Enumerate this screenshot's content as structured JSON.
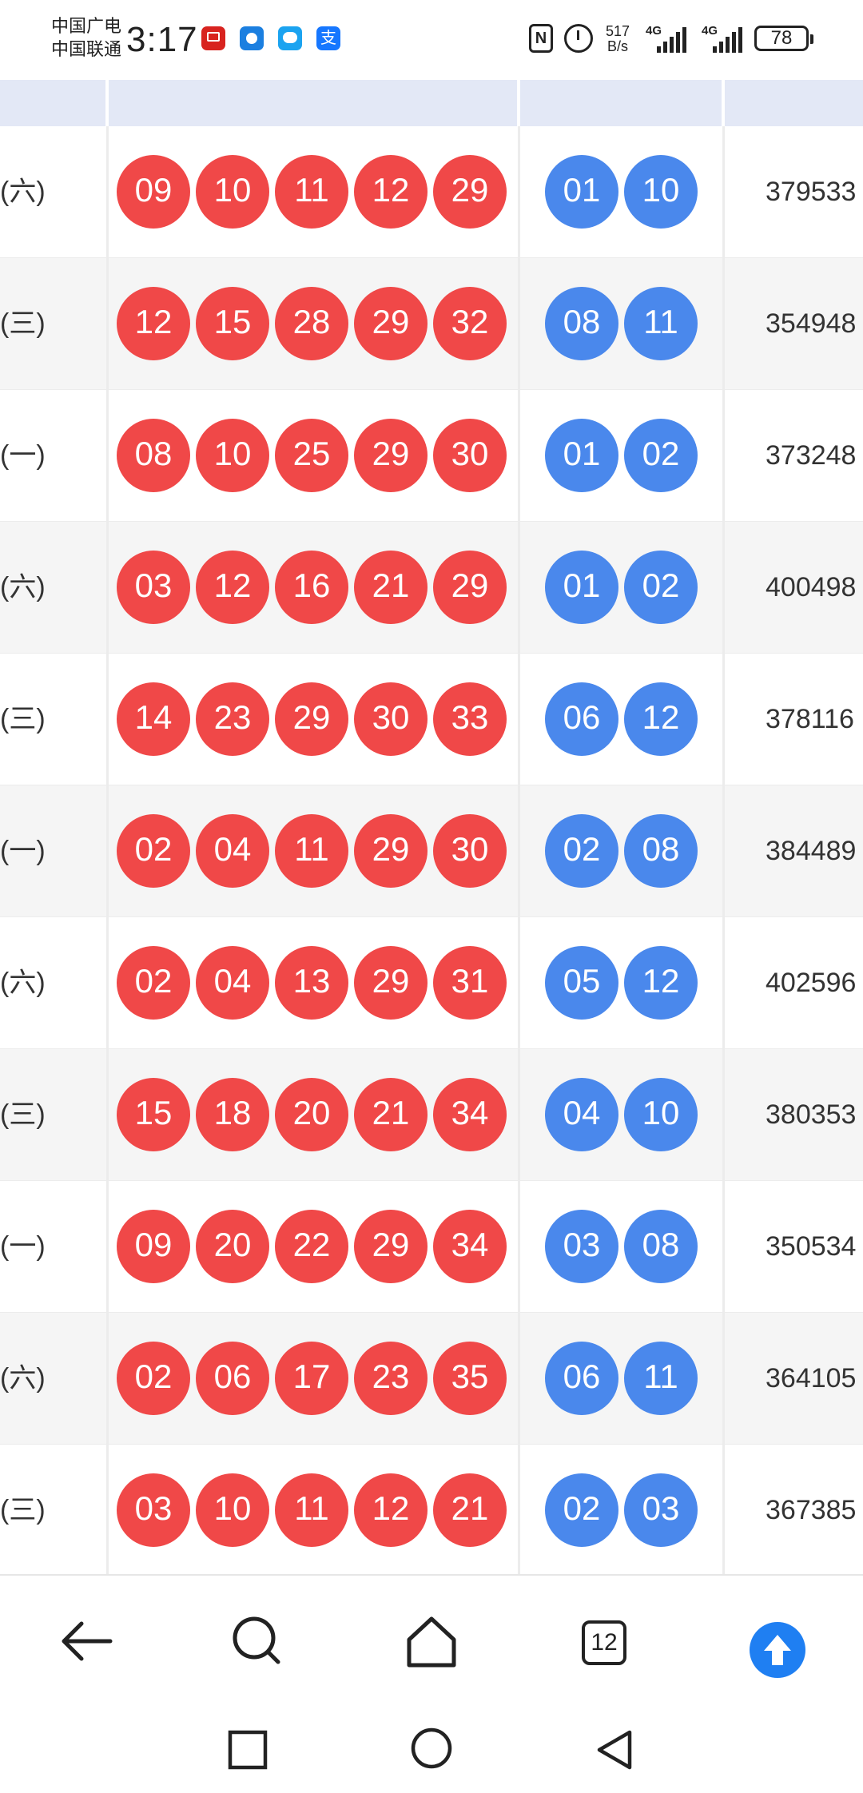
{
  "status_bar": {
    "carrier_line1": "中国广电",
    "carrier_line2": "中国联通",
    "time": "3:17",
    "net_speed_value": "517",
    "net_speed_unit": "B/s",
    "sim1_label": "4G",
    "sim2_label": "4G",
    "battery_level": "78",
    "nfc_label": "N",
    "alipay_label": "支"
  },
  "table": {
    "header_color": "#e3e8f6",
    "red_ball_color": "#f04848",
    "blue_ball_color": "#4a88ec",
    "rows": [
      {
        "week": "(六)",
        "red": [
          "09",
          "10",
          "11",
          "12",
          "29"
        ],
        "blue": [
          "01",
          "10"
        ],
        "sales": "379533"
      },
      {
        "week": "(三)",
        "red": [
          "12",
          "15",
          "28",
          "29",
          "32"
        ],
        "blue": [
          "08",
          "11"
        ],
        "sales": "354948"
      },
      {
        "week": "(一)",
        "red": [
          "08",
          "10",
          "25",
          "29",
          "30"
        ],
        "blue": [
          "01",
          "02"
        ],
        "sales": "373248"
      },
      {
        "week": "(六)",
        "red": [
          "03",
          "12",
          "16",
          "21",
          "29"
        ],
        "blue": [
          "01",
          "02"
        ],
        "sales": "400498"
      },
      {
        "week": "(三)",
        "red": [
          "14",
          "23",
          "29",
          "30",
          "33"
        ],
        "blue": [
          "06",
          "12"
        ],
        "sales": "378116"
      },
      {
        "week": "(一)",
        "red": [
          "02",
          "04",
          "11",
          "29",
          "30"
        ],
        "blue": [
          "02",
          "08"
        ],
        "sales": "384489"
      },
      {
        "week": "(六)",
        "red": [
          "02",
          "04",
          "13",
          "29",
          "31"
        ],
        "blue": [
          "05",
          "12"
        ],
        "sales": "402596"
      },
      {
        "week": "(三)",
        "red": [
          "15",
          "18",
          "20",
          "21",
          "34"
        ],
        "blue": [
          "04",
          "10"
        ],
        "sales": "380353"
      },
      {
        "week": "(一)",
        "red": [
          "09",
          "20",
          "22",
          "29",
          "34"
        ],
        "blue": [
          "03",
          "08"
        ],
        "sales": "350534"
      },
      {
        "week": "(六)",
        "red": [
          "02",
          "06",
          "17",
          "23",
          "35"
        ],
        "blue": [
          "06",
          "11"
        ],
        "sales": "364105"
      },
      {
        "week": "(三)",
        "red": [
          "03",
          "10",
          "11",
          "12",
          "21"
        ],
        "blue": [
          "02",
          "03"
        ],
        "sales": "367385"
      }
    ]
  },
  "browser_bar": {
    "tab_count": "12",
    "icons": [
      "back-arrow-icon",
      "search-icon",
      "home-icon",
      "tabs-icon",
      "scroll-up-icon"
    ]
  },
  "system_nav": {
    "icons": [
      "recents-icon",
      "home-circle-icon",
      "back-triangle-icon"
    ]
  }
}
